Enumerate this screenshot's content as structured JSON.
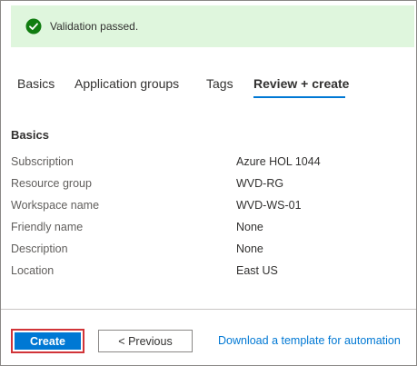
{
  "validation": {
    "message": "Validation passed.",
    "status_color": "#107c10",
    "banner_color": "#dff6dd",
    "icon": "check-circle-icon"
  },
  "tabs": [
    {
      "label": "Basics",
      "selected": false
    },
    {
      "label": "Application groups",
      "selected": false
    },
    {
      "label": "Tags",
      "selected": false
    },
    {
      "label": "Review + create",
      "selected": true
    }
  ],
  "section": {
    "title": "Basics"
  },
  "summary": [
    {
      "label": "Subscription",
      "value": "Azure HOL 1044"
    },
    {
      "label": "Resource group",
      "value": "WVD-RG"
    },
    {
      "label": "Workspace name",
      "value": "WVD-WS-01"
    },
    {
      "label": "Friendly name",
      "value": "None"
    },
    {
      "label": "Description",
      "value": "None"
    },
    {
      "label": "Location",
      "value": "East US"
    }
  ],
  "footer": {
    "create_label": "Create",
    "previous_label": "< Previous",
    "download_label": "Download a template for automation"
  },
  "colors": {
    "accent": "#0078d4",
    "highlight_outline": "#d13438"
  }
}
